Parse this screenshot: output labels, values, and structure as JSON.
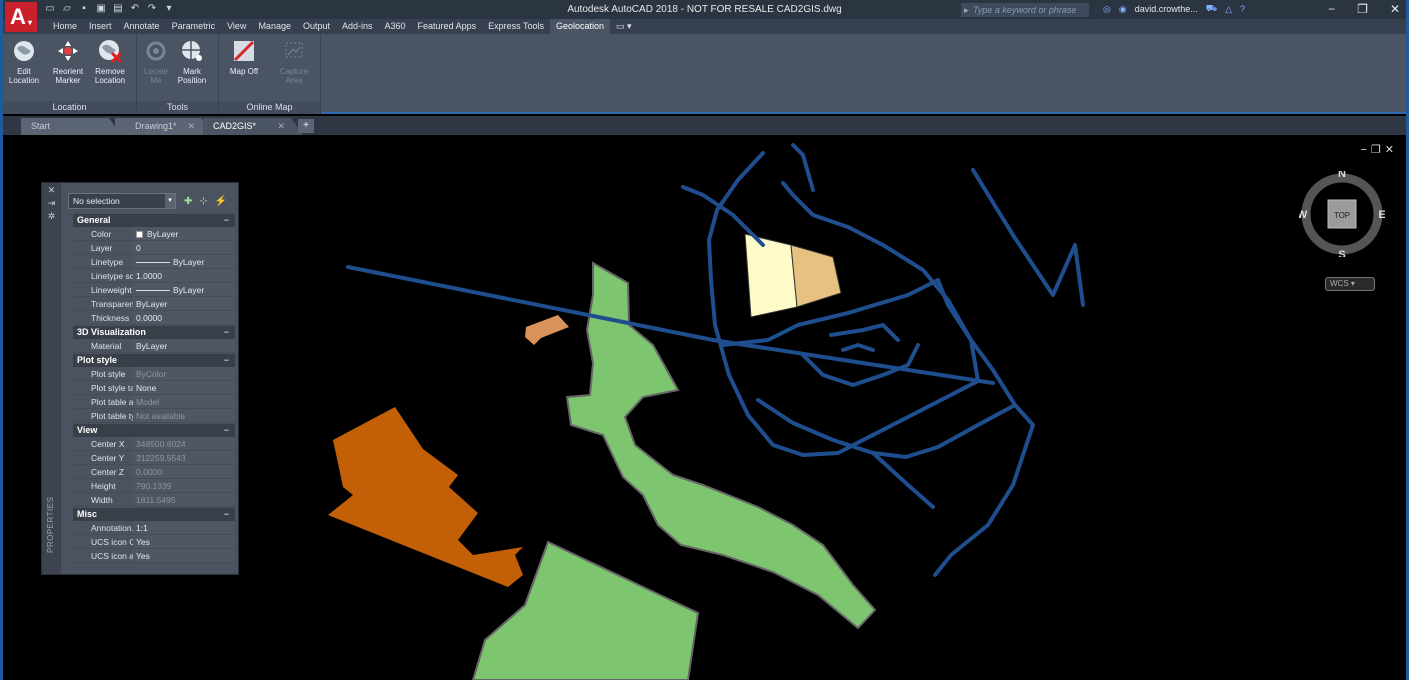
{
  "title_bar": {
    "window_title": "Autodesk AutoCAD 2018 - NOT FOR RESALE    CAD2GIS.dwg",
    "search_placeholder": "Type a keyword or phrase",
    "user_name": "david.crowthe..."
  },
  "ribbon_tabs": [
    "Home",
    "Insert",
    "Annotate",
    "Parametric",
    "View",
    "Manage",
    "Output",
    "Add-ins",
    "A360",
    "Featured Apps",
    "Express Tools",
    "Geolocation"
  ],
  "active_ribbon_tab": "Geolocation",
  "ribbon": {
    "location_group": {
      "title": "Location",
      "edit_location": "Edit\nLocation",
      "reorient_marker": "Reorient\nMarker",
      "remove_location": "Remove\nLocation"
    },
    "tools_group": {
      "title": "Tools",
      "locate_me": "Locate\nMe",
      "mark_position": "Mark\nPosition"
    },
    "online_map_group": {
      "title": "Online Map",
      "map_off": "Map Off",
      "capture_area": "Capture\nArea"
    }
  },
  "doc_tabs": [
    {
      "label": "Start"
    },
    {
      "label": "Drawing1*"
    },
    {
      "label": "CAD2GIS*"
    }
  ],
  "active_doc_tab": "CAD2GIS*",
  "viewcube": {
    "face": "TOP",
    "north": "N",
    "south": "S",
    "east": "E",
    "west": "W",
    "ucs_label": "WCS"
  },
  "properties": {
    "palette_label": "PROPERTIES",
    "selection": "No selection",
    "sections": {
      "general": {
        "title": "General",
        "color": {
          "name": "Color",
          "value": "ByLayer"
        },
        "layer": {
          "name": "Layer",
          "value": "0"
        },
        "linetype": {
          "name": "Linetype",
          "value": "ByLayer"
        },
        "linetype_scale": {
          "name": "Linetype sca...",
          "value": "1.0000"
        },
        "lineweight": {
          "name": "Lineweight",
          "value": "ByLayer"
        },
        "transparency": {
          "name": "Transparency",
          "value": "ByLayer"
        },
        "thickness": {
          "name": "Thickness",
          "value": "0.0000"
        }
      },
      "visualization": {
        "title": "3D Visualization",
        "material": {
          "name": "Material",
          "value": "ByLayer"
        }
      },
      "plot_style": {
        "title": "Plot style",
        "plot_style": {
          "name": "Plot style",
          "value": "ByColor"
        },
        "plot_style_table": {
          "name": "Plot style ta...",
          "value": "None"
        },
        "plot_table_attached": {
          "name": "Plot table at...",
          "value": "Model"
        },
        "plot_table_type": {
          "name": "Plot table ty...",
          "value": "Not available"
        }
      },
      "view": {
        "title": "View",
        "center_x": {
          "name": "Center X",
          "value": "348500.6024"
        },
        "center_y": {
          "name": "Center Y",
          "value": "312259.5543"
        },
        "center_z": {
          "name": "Center Z",
          "value": "0.0000"
        },
        "height": {
          "name": "Height",
          "value": "790.1339"
        },
        "width": {
          "name": "Width",
          "value": "1811.5495"
        }
      },
      "misc": {
        "title": "Misc",
        "annotation_scale": {
          "name": "Annotation...",
          "value": "1:1"
        },
        "ucs_icon_on": {
          "name": "UCS icon On",
          "value": "Yes"
        },
        "ucs_icon_at_origin": {
          "name": "UCS icon at...",
          "value": "Yes"
        }
      }
    }
  },
  "colors": {
    "road_blue": "#1f4e8f",
    "park_green": "#7ec56f",
    "building_orange": "#c35f07",
    "building_tan": "#d9935a",
    "parcel_cream": "#fefbc9",
    "parcel_tan": "#e6c17f",
    "app_red": "#c9202b"
  }
}
